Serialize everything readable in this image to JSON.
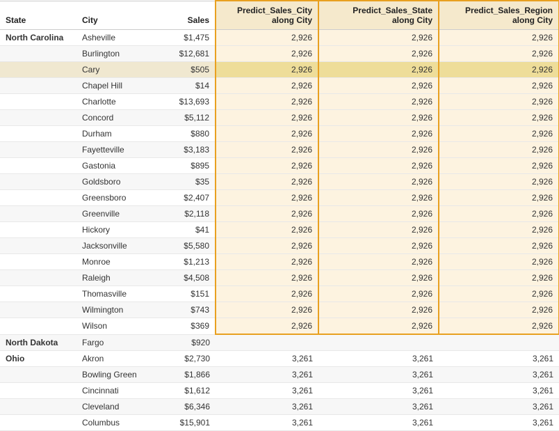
{
  "headers": {
    "state": "State",
    "city": "City",
    "sales": "Sales",
    "predict_city": "Predict_Sales_City\nalong City",
    "predict_state": "Predict_Sales_State\nalong City",
    "predict_region": "Predict_Sales_Region\nalong City"
  },
  "rows": [
    {
      "state": "North Carolina",
      "city": "Asheville",
      "sales": "$1,475",
      "p1": "2,926",
      "p2": "2,926",
      "p3": "2,926",
      "highlight": false,
      "cary": false,
      "nc_last": false
    },
    {
      "state": "",
      "city": "Burlington",
      "sales": "$12,681",
      "p1": "2,926",
      "p2": "2,926",
      "p3": "2,926",
      "highlight": false,
      "cary": false,
      "nc_last": false
    },
    {
      "state": "",
      "city": "Cary",
      "sales": "$505",
      "p1": "2,926",
      "p2": "2,926",
      "p3": "2,926",
      "highlight": false,
      "cary": true,
      "nc_last": false
    },
    {
      "state": "",
      "city": "Chapel Hill",
      "sales": "$14",
      "p1": "2,926",
      "p2": "2,926",
      "p3": "2,926",
      "highlight": false,
      "cary": false,
      "nc_last": false
    },
    {
      "state": "",
      "city": "Charlotte",
      "sales": "$13,693",
      "p1": "2,926",
      "p2": "2,926",
      "p3": "2,926",
      "highlight": false,
      "cary": false,
      "nc_last": false
    },
    {
      "state": "",
      "city": "Concord",
      "sales": "$5,112",
      "p1": "2,926",
      "p2": "2,926",
      "p3": "2,926",
      "highlight": false,
      "cary": false,
      "nc_last": false
    },
    {
      "state": "",
      "city": "Durham",
      "sales": "$880",
      "p1": "2,926",
      "p2": "2,926",
      "p3": "2,926",
      "highlight": false,
      "cary": false,
      "nc_last": false
    },
    {
      "state": "",
      "city": "Fayetteville",
      "sales": "$3,183",
      "p1": "2,926",
      "p2": "2,926",
      "p3": "2,926",
      "highlight": false,
      "cary": false,
      "nc_last": false
    },
    {
      "state": "",
      "city": "Gastonia",
      "sales": "$895",
      "p1": "2,926",
      "p2": "2,926",
      "p3": "2,926",
      "highlight": false,
      "cary": false,
      "nc_last": false
    },
    {
      "state": "",
      "city": "Goldsboro",
      "sales": "$35",
      "p1": "2,926",
      "p2": "2,926",
      "p3": "2,926",
      "highlight": false,
      "cary": false,
      "nc_last": false
    },
    {
      "state": "",
      "city": "Greensboro",
      "sales": "$2,407",
      "p1": "2,926",
      "p2": "2,926",
      "p3": "2,926",
      "highlight": false,
      "cary": false,
      "nc_last": false
    },
    {
      "state": "",
      "city": "Greenville",
      "sales": "$2,118",
      "p1": "2,926",
      "p2": "2,926",
      "p3": "2,926",
      "highlight": false,
      "cary": false,
      "nc_last": false
    },
    {
      "state": "",
      "city": "Hickory",
      "sales": "$41",
      "p1": "2,926",
      "p2": "2,926",
      "p3": "2,926",
      "highlight": false,
      "cary": false,
      "nc_last": false
    },
    {
      "state": "",
      "city": "Jacksonville",
      "sales": "$5,580",
      "p1": "2,926",
      "p2": "2,926",
      "p3": "2,926",
      "highlight": false,
      "cary": false,
      "nc_last": false
    },
    {
      "state": "",
      "city": "Monroe",
      "sales": "$1,213",
      "p1": "2,926",
      "p2": "2,926",
      "p3": "2,926",
      "highlight": false,
      "cary": false,
      "nc_last": false
    },
    {
      "state": "",
      "city": "Raleigh",
      "sales": "$4,508",
      "p1": "2,926",
      "p2": "2,926",
      "p3": "2,926",
      "highlight": false,
      "cary": false,
      "nc_last": false
    },
    {
      "state": "",
      "city": "Thomasville",
      "sales": "$151",
      "p1": "2,926",
      "p2": "2,926",
      "p3": "2,926",
      "highlight": false,
      "cary": false,
      "nc_last": false
    },
    {
      "state": "",
      "city": "Wilmington",
      "sales": "$743",
      "p1": "2,926",
      "p2": "2,926",
      "p3": "2,926",
      "highlight": false,
      "cary": false,
      "nc_last": false
    },
    {
      "state": "",
      "city": "Wilson",
      "sales": "$369",
      "p1": "2,926",
      "p2": "2,926",
      "p3": "2,926",
      "highlight": false,
      "cary": false,
      "nc_last": true
    },
    {
      "state": "North Dakota",
      "city": "Fargo",
      "sales": "$920",
      "p1": "",
      "p2": "",
      "p3": "",
      "highlight": false,
      "cary": false,
      "nc_last": false
    },
    {
      "state": "Ohio",
      "city": "Akron",
      "sales": "$2,730",
      "p1": "3,261",
      "p2": "3,261",
      "p3": "3,261",
      "highlight": false,
      "cary": false,
      "nc_last": false
    },
    {
      "state": "",
      "city": "Bowling Green",
      "sales": "$1,866",
      "p1": "3,261",
      "p2": "3,261",
      "p3": "3,261",
      "highlight": false,
      "cary": false,
      "nc_last": false
    },
    {
      "state": "",
      "city": "Cincinnati",
      "sales": "$1,612",
      "p1": "3,261",
      "p2": "3,261",
      "p3": "3,261",
      "highlight": false,
      "cary": false,
      "nc_last": false
    },
    {
      "state": "",
      "city": "Cleveland",
      "sales": "$6,346",
      "p1": "3,261",
      "p2": "3,261",
      "p3": "3,261",
      "highlight": false,
      "cary": false,
      "nc_last": false
    },
    {
      "state": "",
      "city": "Columbus",
      "sales": "$15,901",
      "p1": "3,261",
      "p2": "3,261",
      "p3": "3,261",
      "highlight": false,
      "cary": false,
      "nc_last": false
    }
  ]
}
